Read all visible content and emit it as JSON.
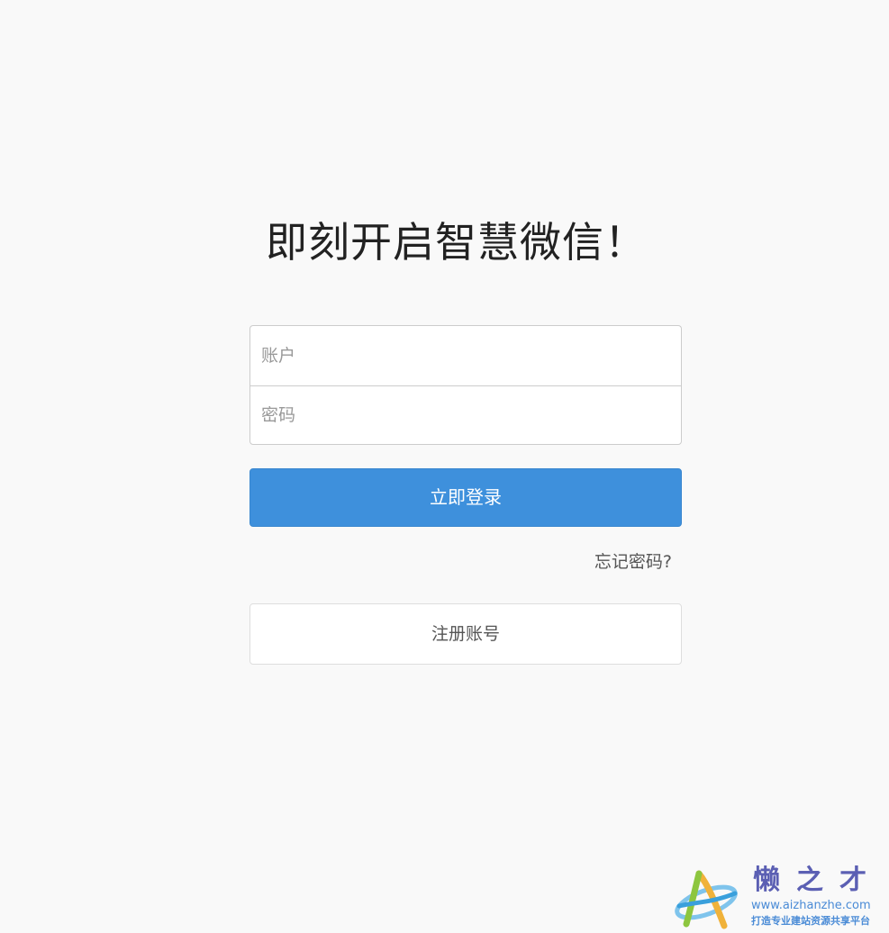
{
  "page": {
    "headline": "即刻开启智慧微信！"
  },
  "login_form": {
    "account_placeholder": "账户",
    "password_placeholder": "密码",
    "submit_label": "立即登录",
    "forgot_password_label": "忘记密码?",
    "register_label": "注册账号"
  },
  "watermark": {
    "title": "懒之才",
    "url": "www.aizhanzhe.com",
    "tagline": "打造专业建站资源共享平台"
  },
  "colors": {
    "background": "#f9f9f9",
    "primary_button": "#3e90dc",
    "watermark": "#5b5fb3"
  }
}
